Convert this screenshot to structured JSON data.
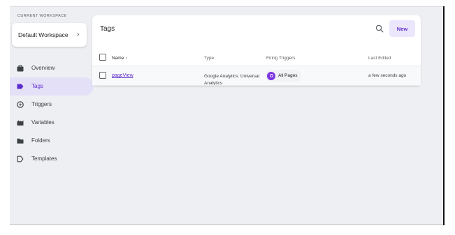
{
  "sidebar": {
    "workspace_label": "CURRENT WORKSPACE",
    "workspace_name": "Default Workspace",
    "workspace_chevron": "›",
    "items": [
      {
        "label": "Overview",
        "icon": "briefcase-icon",
        "active": false
      },
      {
        "label": "Tags",
        "icon": "tag-icon",
        "active": true
      },
      {
        "label": "Triggers",
        "icon": "trigger-icon",
        "active": false
      },
      {
        "label": "Variables",
        "icon": "variables-icon",
        "active": false
      },
      {
        "label": "Folders",
        "icon": "folder-icon",
        "active": false
      },
      {
        "label": "Templates",
        "icon": "template-icon",
        "active": false
      }
    ]
  },
  "main": {
    "title": "Tags",
    "new_button": "New",
    "columns": {
      "name": "Name ↑",
      "type": "Type",
      "triggers": "Firing Triggers",
      "last_edited": "Last Edited"
    },
    "rows": [
      {
        "name": "pageView",
        "type": "Google Analytics: Universal Analytics",
        "trigger": "All Pages",
        "last_edited": "a few seconds ago"
      }
    ]
  },
  "colors": {
    "accent": "#5d2dcc",
    "active_nav_bg": "#e3e0f8",
    "new_button_bg": "#ece6fd",
    "trigger_dot": "#7b34e3"
  }
}
